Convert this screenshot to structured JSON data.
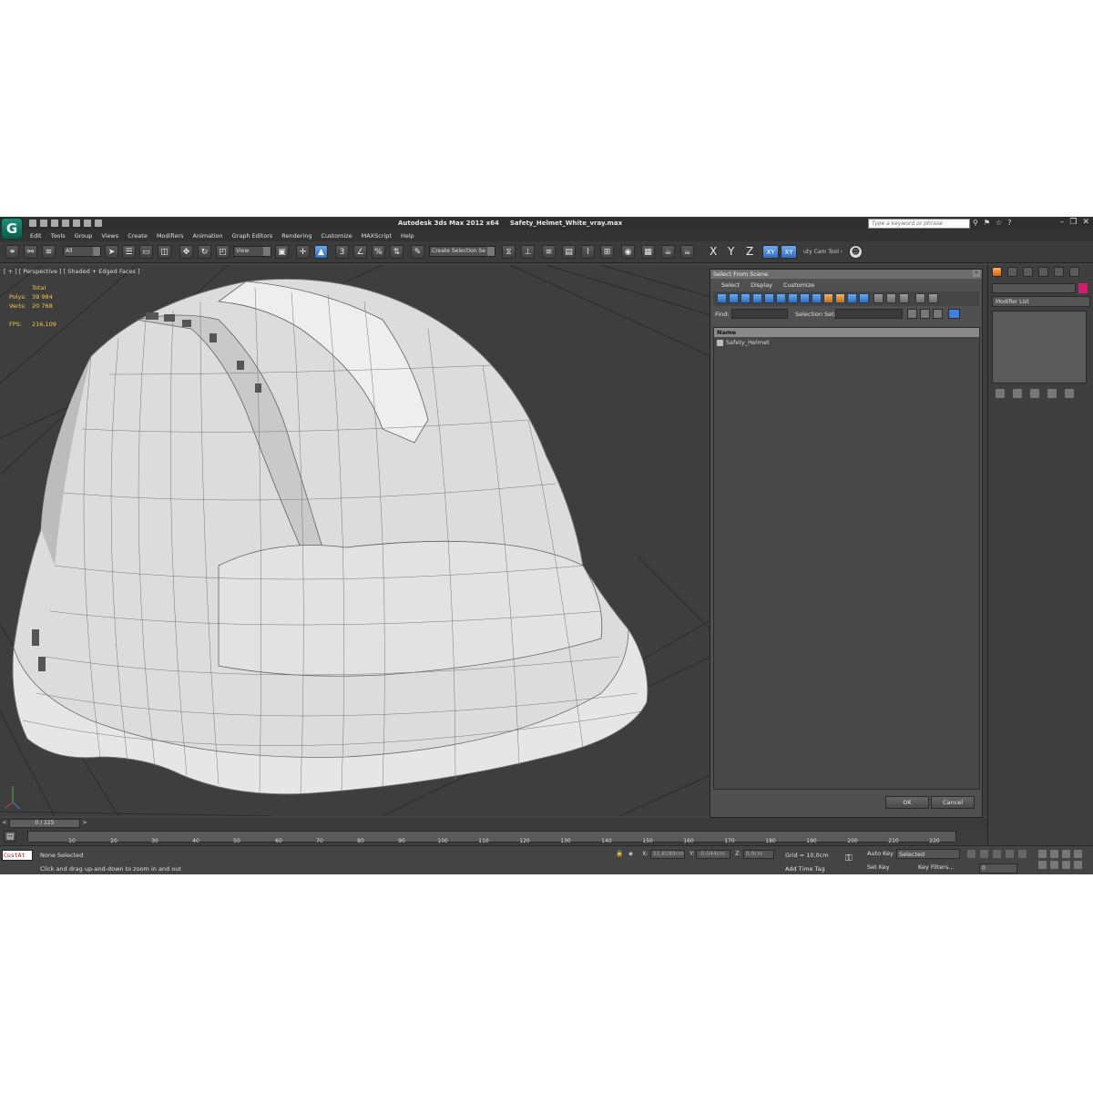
{
  "window": {
    "app_name": "Autodesk 3ds Max  2012 x64",
    "file_name": "Safety_Helmet_White_vray.max",
    "search_placeholder": "Type a keyword or phrase",
    "logo_glyph": "G"
  },
  "menu": [
    "Edit",
    "Tools",
    "Group",
    "Views",
    "Create",
    "Modifiers",
    "Animation",
    "Graph Editors",
    "Rendering",
    "Customize",
    "MAXScript",
    "Help"
  ],
  "toolbar": {
    "filter_value": "All",
    "ref_coord_value": "View",
    "snap_angle_label": "3",
    "selection_set_value": "Create Selection Se",
    "axis_x": "X",
    "axis_y": "Y",
    "axis_z": "Z",
    "axis_xy": "XY",
    "axis_xy2": "XY",
    "cam_tool_label": "uty Cam Tool ›"
  },
  "viewport": {
    "label": "[ + ] [ Perspective ] [ Shaded + Edged Faces ]",
    "stats_header": "Total",
    "polys_label": "Polys:",
    "polys_value": "39 984",
    "verts_label": "Verts:",
    "verts_value": "20 768",
    "fps_label": "FPS:",
    "fps_value": "216,109",
    "bg_color": "#3e3e3e",
    "stats_color": "#f2c94c"
  },
  "dialog": {
    "title": "Select From Scene",
    "menu": [
      "Select",
      "Display",
      "Customize"
    ],
    "find_label": "Find:",
    "selection_set_label": "Selection Set:",
    "column_name": "Name",
    "items": [
      {
        "name": "Safety_Helmet"
      }
    ],
    "ok_label": "OK",
    "cancel_label": "Cancel"
  },
  "command_panel": {
    "modifier_list_label": "Modifier List",
    "object_color": "#d01f6f"
  },
  "timeline": {
    "frame_display": "0 / 225",
    "prev_arrow": "<",
    "next_arrow": ">",
    "ticks": [
      "10",
      "20",
      "30",
      "40",
      "50",
      "60",
      "70",
      "80",
      "90",
      "100",
      "110",
      "120",
      "130",
      "140",
      "150",
      "160",
      "170",
      "180",
      "190",
      "200",
      "210",
      "220"
    ]
  },
  "status": {
    "script_text": "CustAt",
    "selection_text": "None Selected",
    "prompt_text": "Click and drag up-and-down to zoom in and out",
    "x_label": "X:",
    "x_value": "22,8189cm",
    "y_label": "Y:",
    "y_value": "-0,044cm",
    "z_label": "Z:",
    "z_value": "0,0cm",
    "grid_text": "Grid = 10,0cm",
    "add_time_tag": "Add Time Tag",
    "auto_key": "Auto Key",
    "auto_key_value": "Selected",
    "set_key": "Set Key",
    "key_filters": "Key Filters...",
    "frame_value": "0"
  }
}
